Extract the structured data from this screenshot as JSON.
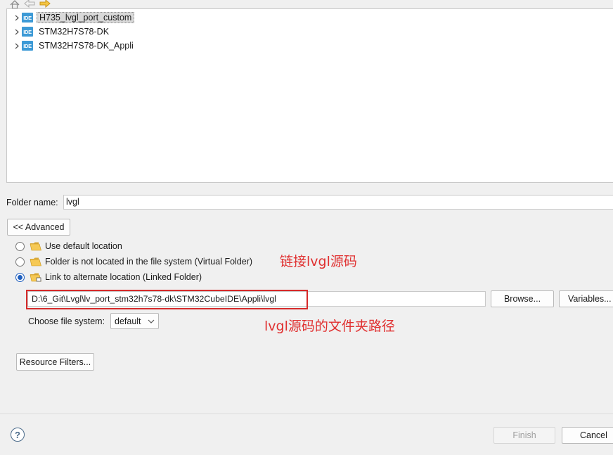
{
  "tree": {
    "items": [
      {
        "label": "H735_lvgl_port_custom",
        "icon": "IDE",
        "selected": true
      },
      {
        "label": "STM32H7S78-DK",
        "icon": "IDE",
        "selected": false
      },
      {
        "label": "STM32H7S78-DK_Appli",
        "icon": "IDE",
        "selected": false
      }
    ]
  },
  "folder_name": {
    "label": "Folder name:",
    "value": "lvgl"
  },
  "advanced_button": "<< Advanced",
  "location_options": {
    "default": "Use default location",
    "virtual": "Folder is not located in the file system (Virtual Folder)",
    "linked": "Link to alternate location (Linked Folder)",
    "selected": "linked"
  },
  "annotations": {
    "link_note": "链接lvgl源码",
    "path_note": "lvgl源码的文件夹路径"
  },
  "linked_path": "D:\\6_Git\\Lvgl\\lv_port_stm32h7s78-dk\\STM32CubeIDE\\Appli\\lvgl",
  "browse_button": "Browse...",
  "variables_button": "Variables...",
  "file_system": {
    "label": "Choose file system:",
    "value": "default"
  },
  "resource_filters_button": "Resource Filters...",
  "footer": {
    "help": "?",
    "finish": "Finish",
    "cancel": "Cancel"
  },
  "colors": {
    "annotation_red": "#e03030",
    "ide_icon": "#3d9ad6",
    "radio_accent": "#1f5fbf"
  }
}
